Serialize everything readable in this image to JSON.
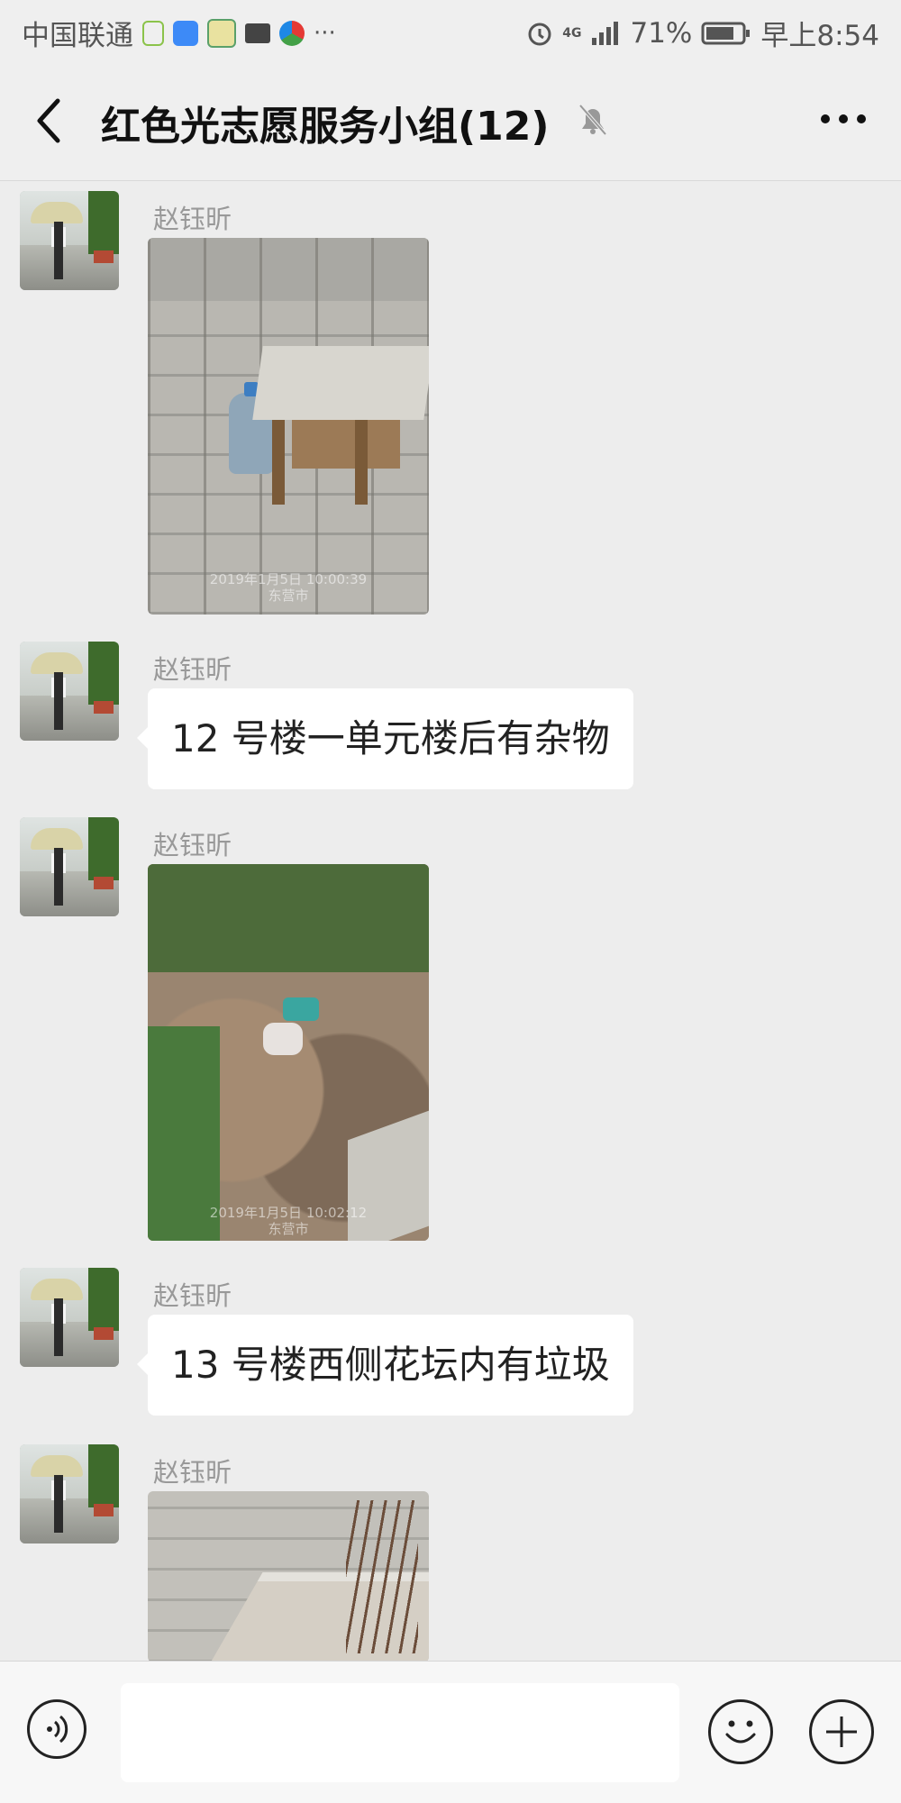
{
  "status_bar": {
    "carrier": "中国联通",
    "extra_icons": "···",
    "network": "4G",
    "battery": "71%",
    "time": "早上8:54"
  },
  "header": {
    "title": "红色光志愿服务小组(12)",
    "back_icon": "chevron-left-icon",
    "mute_icon": "bell-off-icon",
    "more_icon": "more-horizontal-icon"
  },
  "messages": [
    {
      "sender": "赵钰昕",
      "type": "image",
      "stamp_line1": "2019年1月5日 10:00:39",
      "stamp_line2": "东营市"
    },
    {
      "sender": "赵钰昕",
      "type": "text",
      "text": "12 号楼一单元楼后有杂物"
    },
    {
      "sender": "赵钰昕",
      "type": "image",
      "stamp_line1": "2019年1月5日 10:02:12",
      "stamp_line2": "东营市"
    },
    {
      "sender": "赵钰昕",
      "type": "text",
      "text": "13 号楼西侧花坛内有垃圾"
    },
    {
      "sender": "赵钰昕",
      "type": "image"
    }
  ],
  "input_bar": {
    "voice_icon": "voice-icon",
    "text_value": "",
    "emoji_icon": "emoji-icon",
    "plus_icon": "plus-icon"
  }
}
